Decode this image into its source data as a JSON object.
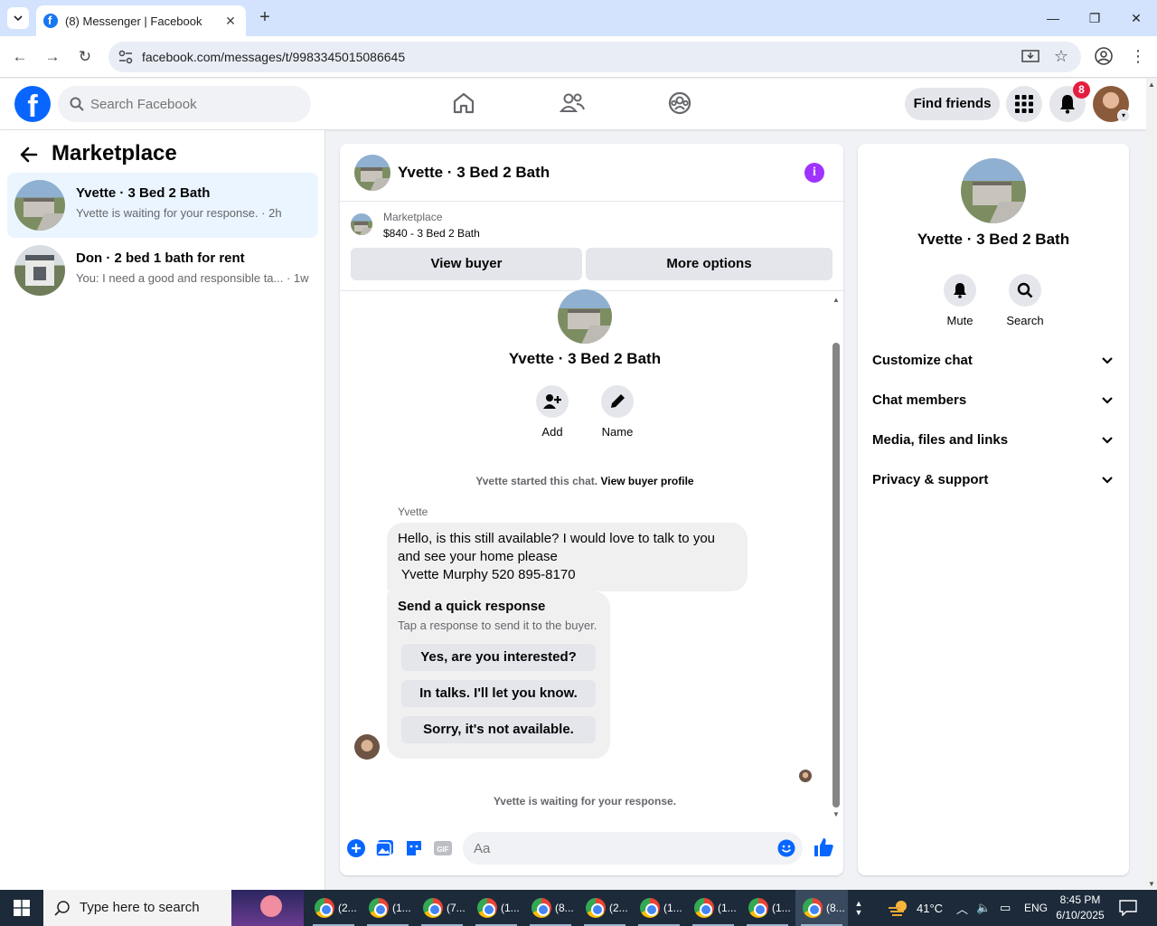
{
  "browser": {
    "tab_title": "(8) Messenger | Facebook",
    "url": "facebook.com/messages/t/9983345015086645"
  },
  "fb": {
    "search_placeholder": "Search Facebook",
    "find_friends": "Find friends",
    "notifications_count": "8"
  },
  "sidebar": {
    "title": "Marketplace",
    "conversations": [
      {
        "name": "Yvette · 3 Bed 2 Bath",
        "snippet": "Yvette is waiting for your response. · 2h",
        "active": true
      },
      {
        "name": "Don · 2 bed 1 bath for rent",
        "snippet": "You: I need a good and responsible ta... · 1w",
        "active": false
      }
    ]
  },
  "chat": {
    "title": "Yvette · 3 Bed 2 Bath",
    "listing_source": "Marketplace",
    "listing_price": "$840 - 3 Bed 2 Bath",
    "view_buyer": "View buyer",
    "more_options": "More options",
    "intro_name": "Yvette · 3 Bed 2 Bath",
    "intro_actions": [
      "Add",
      "Name"
    ],
    "started_text": "Yvette started this chat.",
    "view_buyer_profile": "View buyer profile",
    "sender_name": "Yvette",
    "message_lines": [
      "Hello, is this still available? I would love to talk to you",
      "and see your home please",
      " Yvette Murphy 520 895-8170"
    ],
    "quick_title": "Send a quick response",
    "quick_sub": "Tap a response to send it to the buyer.",
    "quick_responses": [
      "Yes, are you interested?",
      "In talks. I'll let you know.",
      "Sorry, it's not available."
    ],
    "waiting_text": "Yvette is waiting for your response.",
    "composer_placeholder": "Aa"
  },
  "info_panel": {
    "name": "Yvette · 3 Bed 2 Bath",
    "actions": [
      "Mute",
      "Search"
    ],
    "sections": [
      "Customize chat",
      "Chat members",
      "Media, files and links",
      "Privacy & support"
    ]
  },
  "taskbar": {
    "search_text": "Type here to search",
    "apps": [
      "(2...",
      "(1...",
      "(7...",
      "(1...",
      "(8...",
      "(2...",
      "(1...",
      "(1...",
      "(1...",
      "(8..."
    ],
    "weather": "41°C",
    "language": "ENG",
    "time": "8:45 PM",
    "date": "6/10/2025"
  },
  "colors": {
    "fb_blue": "#0866ff",
    "messenger_purple": "#a033ff",
    "active_conv_bg": "#ebf5ff",
    "badge_red": "#e41e3f"
  }
}
